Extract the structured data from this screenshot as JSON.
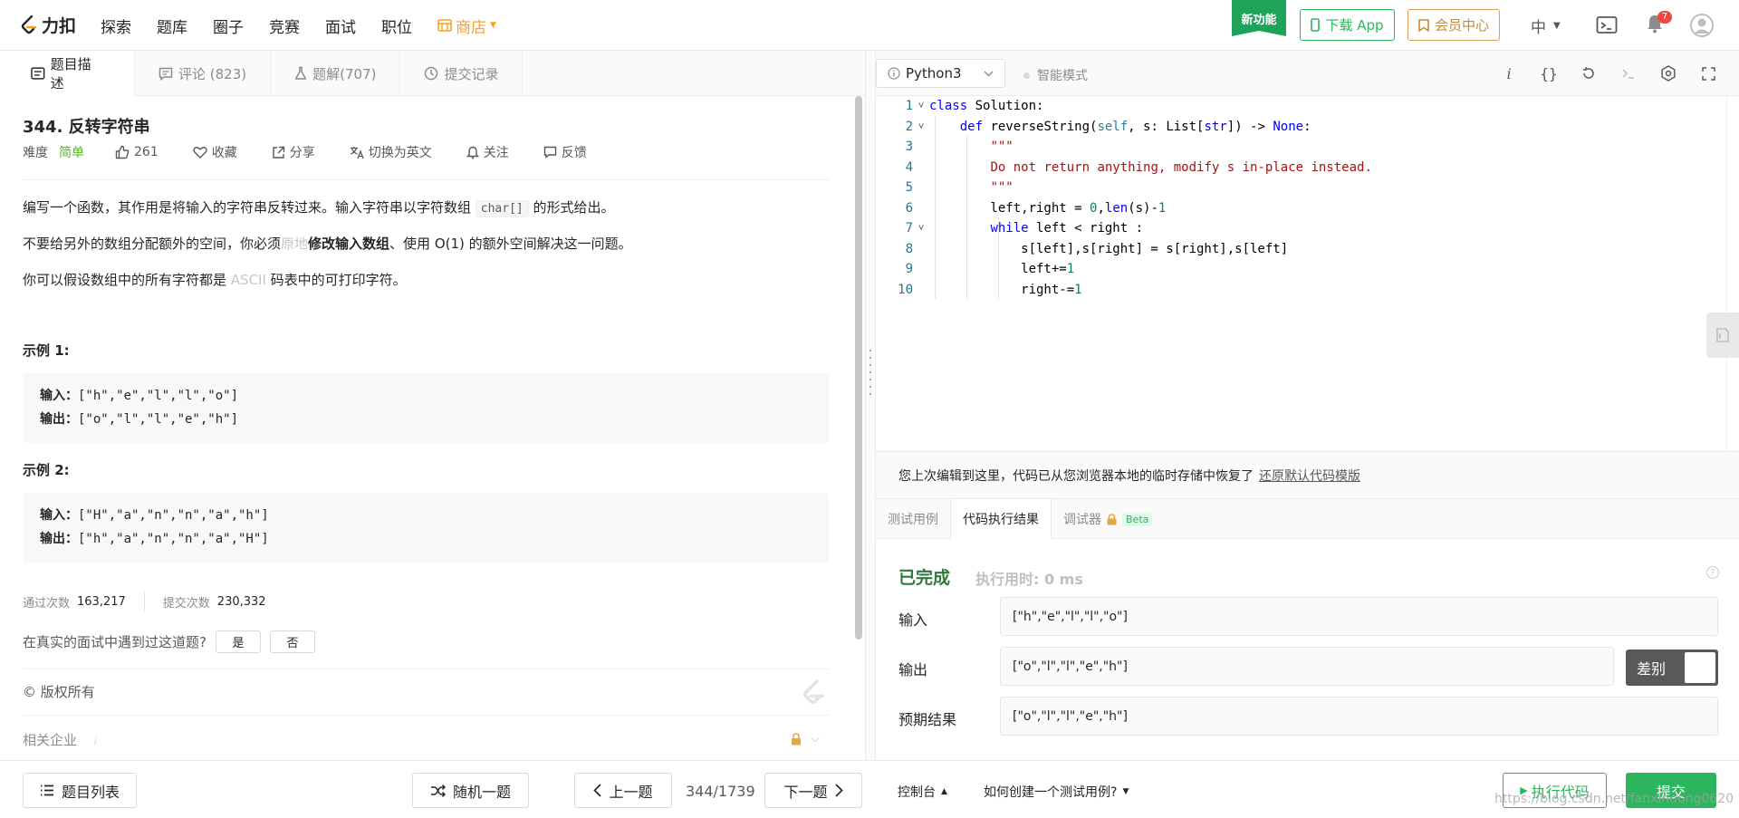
{
  "nav": {
    "logo_text": "力扣",
    "items": [
      "探索",
      "题库",
      "圈子",
      "竞赛",
      "面试",
      "职位"
    ],
    "store": "商店",
    "new_feature": "新功能",
    "download_app": "下载 App",
    "member_center": "会员中心",
    "language": "中",
    "notification_count": "7"
  },
  "left_tabs": [
    {
      "label": "题目描述"
    },
    {
      "label": "评论 (823)"
    },
    {
      "label": "题解(707)"
    },
    {
      "label": "提交记录"
    }
  ],
  "problem": {
    "title": "344. 反转字符串",
    "difficulty_label": "难度",
    "difficulty": "简单",
    "likes": "261",
    "actions": [
      "收藏",
      "分享",
      "切换为英文",
      "关注",
      "反馈"
    ],
    "desc1_a": "编写一个函数，其作用是将输入的字符串反转过来。输入字符串以字符数组 ",
    "desc1_code": "char[]",
    "desc1_b": " 的形式给出。",
    "desc2_a": "不要给另外的数组分配额外的空间，你必须",
    "desc2_muted": "原地",
    "desc2_bold": "修改输入数组",
    "desc2_b": "、使用 O(1) 的额外空间解决这一问题。",
    "desc3_a": "你可以假设数组中的所有字符都是 ",
    "desc3_muted": "ASCII",
    "desc3_b": " 码表中的可打印字符。",
    "example1_title": "示例 1:",
    "example1_input_label": "输入：",
    "example1_input": "[\"h\",\"e\",\"l\",\"l\",\"o\"]",
    "example1_output_label": "输出：",
    "example1_output": "[\"o\",\"l\",\"l\",\"e\",\"h\"]",
    "example2_title": "示例 2:",
    "example2_input_label": "输入：",
    "example2_input": "[\"H\",\"a\",\"n\",\"n\",\"a\",\"h\"]",
    "example2_output_label": "输出：",
    "example2_output": "[\"h\",\"a\",\"n\",\"n\",\"a\",\"H\"]",
    "passed_label": "通过次数",
    "passed": "163,217",
    "submitted_label": "提交次数",
    "submitted": "230,332",
    "interview_q": "在真实的面试中遇到过这道题?",
    "yes": "是",
    "no": "否",
    "copyright": "© 版权所有",
    "related_companies": "相关企业"
  },
  "editor": {
    "language": "Python3",
    "smart_mode": "智能模式",
    "lines": [
      {
        "n": "1",
        "fold": "˅"
      },
      {
        "n": "2",
        "fold": "˅"
      },
      {
        "n": "3",
        "fold": ""
      },
      {
        "n": "4",
        "fold": ""
      },
      {
        "n": "5",
        "fold": ""
      },
      {
        "n": "6",
        "fold": ""
      },
      {
        "n": "7",
        "fold": "˅"
      },
      {
        "n": "8",
        "fold": ""
      },
      {
        "n": "9",
        "fold": ""
      },
      {
        "n": "10",
        "fold": ""
      }
    ],
    "restore_msg": "您上次编辑到这里，代码已从您浏览器本地的临时存储中恢复了",
    "restore_link": "还原默认代码模版"
  },
  "result": {
    "tabs": [
      "测试用例",
      "代码执行结果",
      "调试器"
    ],
    "beta": "Beta",
    "status": "已完成",
    "exec_time": "执行用时: 0 ms",
    "input_label": "输入",
    "input": "[\"h\",\"e\",\"l\",\"l\",\"o\"]",
    "output_label": "输出",
    "output": "[\"o\",\"l\",\"l\",\"e\",\"h\"]",
    "expected_label": "预期结果",
    "expected": "[\"o\",\"l\",\"l\",\"e\",\"h\"]",
    "diff_label": "差别"
  },
  "bottom": {
    "problem_list": "题目列表",
    "random": "随机一题",
    "prev": "上一题",
    "page": "344/1739",
    "next": "下一题",
    "console": "控制台",
    "howto": "如何创建一个测试用例?",
    "run": "执行代码",
    "submit": "提交",
    "watermark": "https://blog.csdn.net/fanxindong0620"
  }
}
